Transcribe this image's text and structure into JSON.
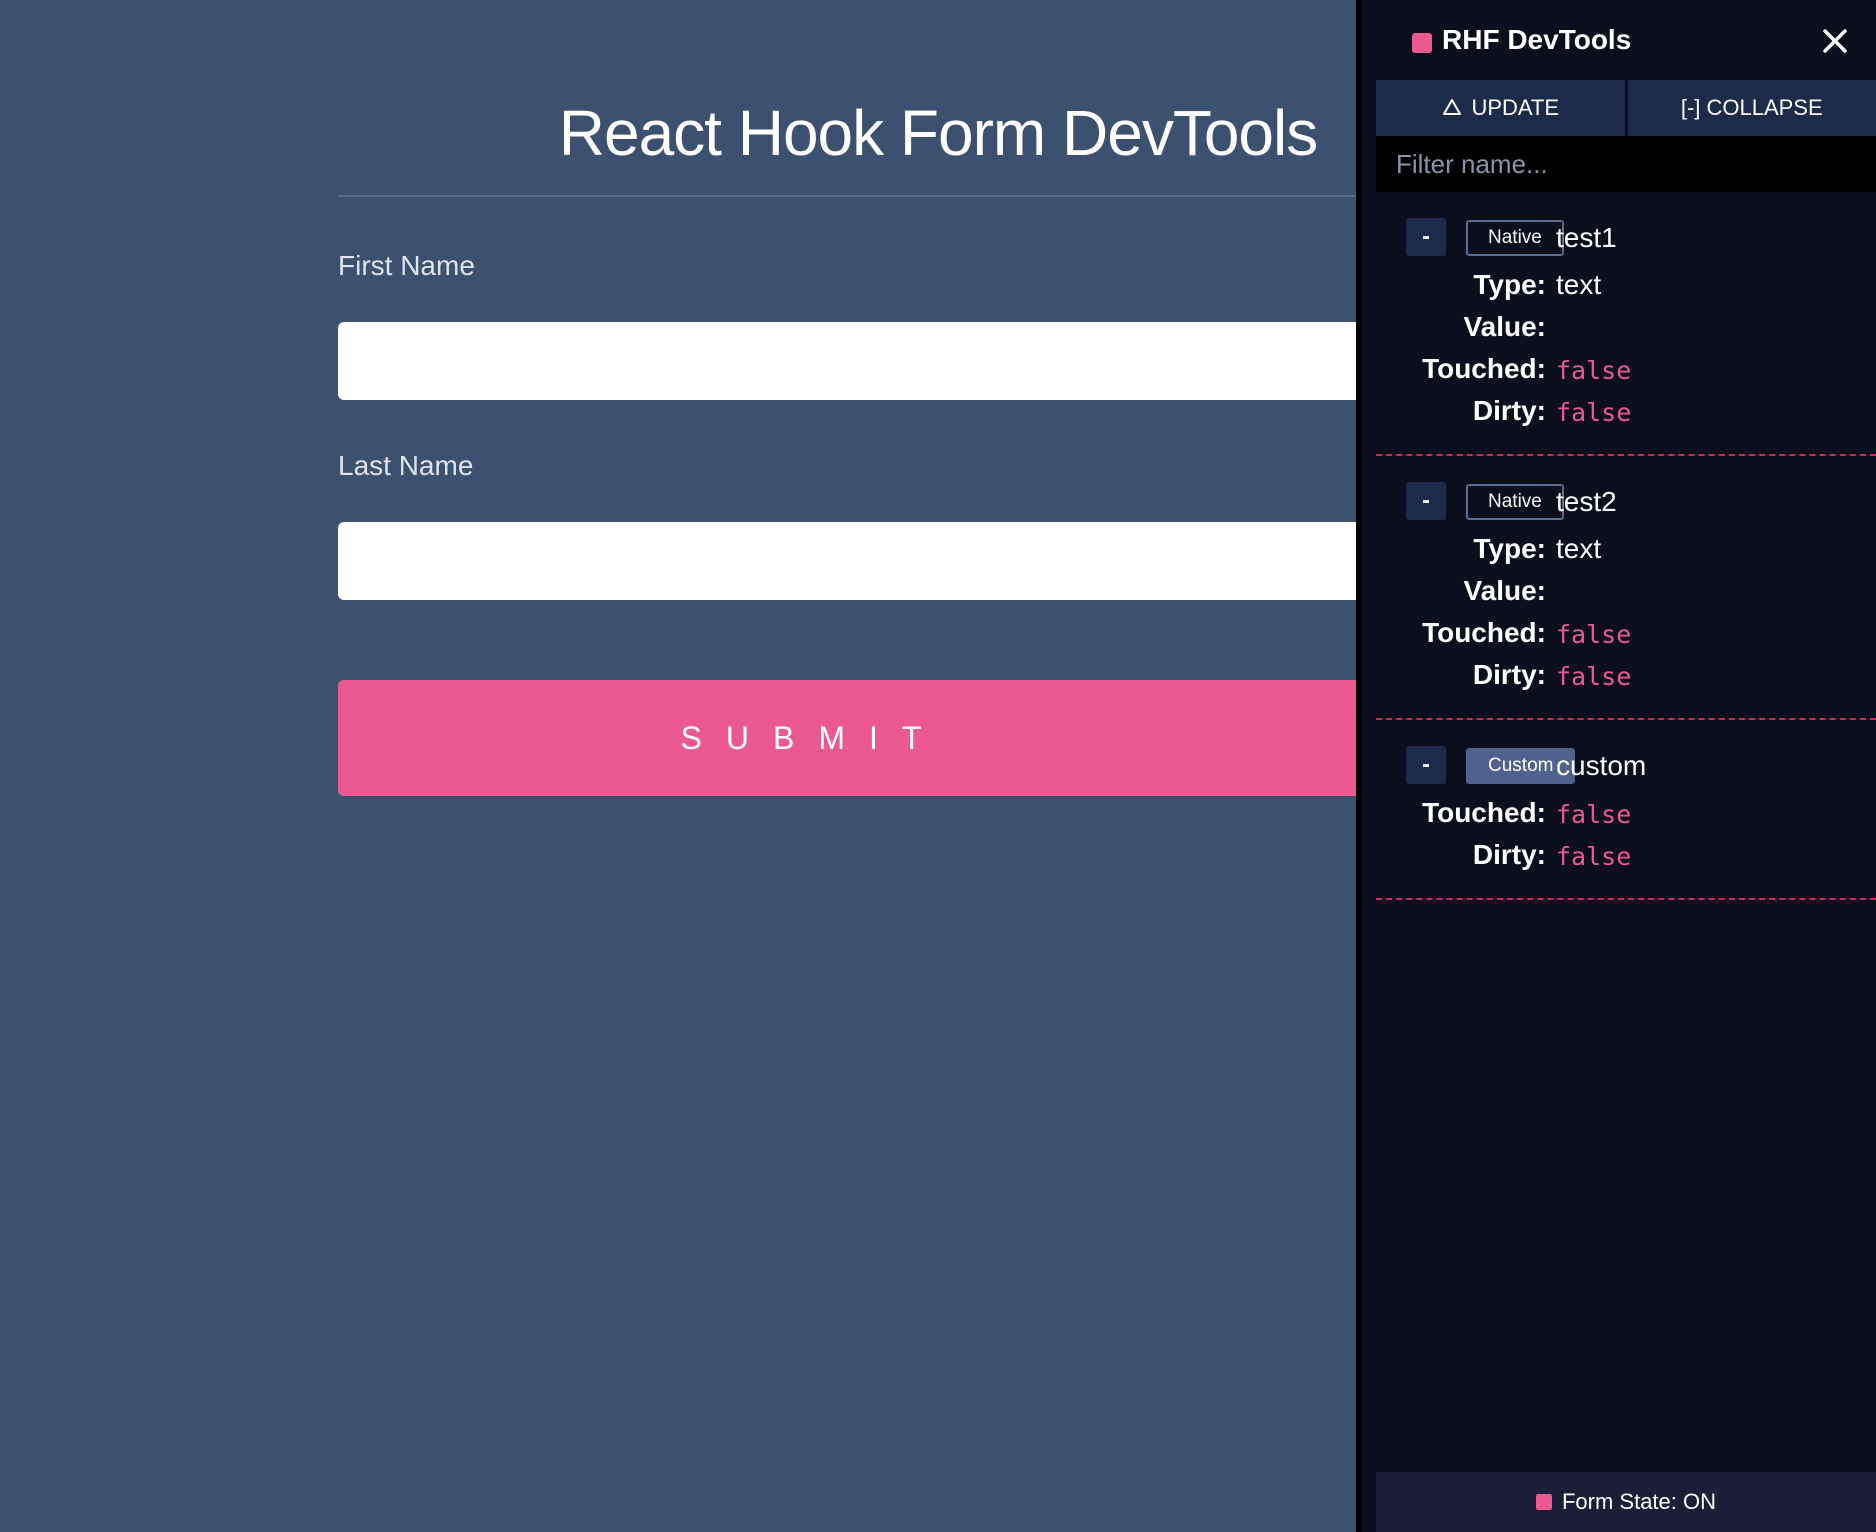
{
  "form": {
    "title": "React Hook Form DevTools",
    "fields": [
      {
        "label": "First Name",
        "value": ""
      },
      {
        "label": "Last Name",
        "value": ""
      }
    ],
    "submit_label": "SUBMIT"
  },
  "devtools": {
    "title": "RHF DevTools",
    "close_icon": "close-icon",
    "actions": {
      "update_label": "UPDATE",
      "collapse_label": "[-] COLLAPSE"
    },
    "filter_placeholder": "Filter name...",
    "fields": [
      {
        "toggle": "-",
        "badge": "Native",
        "name": "test1",
        "rows": [
          {
            "key": "Type:",
            "value": "text"
          },
          {
            "key": "Value:",
            "value": ""
          },
          {
            "key": "Touched:",
            "value": "false"
          },
          {
            "key": "Dirty:",
            "value": "false"
          }
        ]
      },
      {
        "toggle": "-",
        "badge": "Native",
        "name": "test2",
        "rows": [
          {
            "key": "Type:",
            "value": "text"
          },
          {
            "key": "Value:",
            "value": ""
          },
          {
            "key": "Touched:",
            "value": "false"
          },
          {
            "key": "Dirty:",
            "value": "false"
          }
        ]
      },
      {
        "toggle": "-",
        "badge": "Custom",
        "name": "custom",
        "rows": [
          {
            "key": "Touched:",
            "value": "false"
          },
          {
            "key": "Dirty:",
            "value": "false"
          }
        ]
      }
    ],
    "footer_label": "Form State: ON"
  },
  "colors": {
    "background": "#3c506f",
    "accent": "#ec5990",
    "panel": "#0b0e1c",
    "panel_button": "#1d2b4a"
  }
}
